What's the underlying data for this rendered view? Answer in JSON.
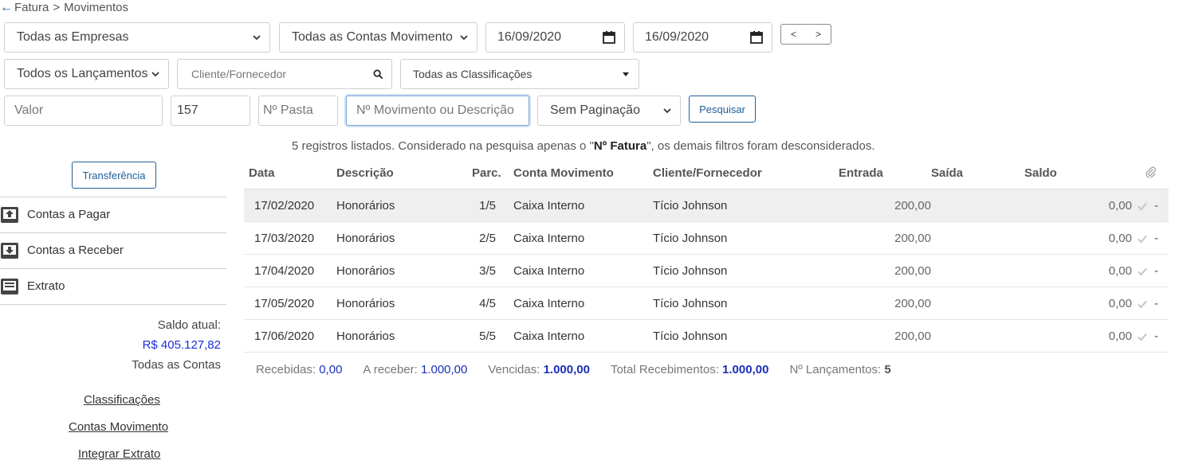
{
  "breadcrumb": {
    "back_icon": "arrow-left-icon",
    "root": "Fatura",
    "separator": ">",
    "current": "Movimentos"
  },
  "filters": {
    "empresas": "Todas as Empresas",
    "contas": "Todas as Contas Movimento",
    "date_from": "16/09/2020",
    "date_to": "16/09/2020",
    "prev": "<",
    "next": ">",
    "lancamentos": "Todos os Lançamentos",
    "cliente_placeholder": "Cliente/Fornecedor",
    "classificacoes": "Todas as Classificações",
    "valor_placeholder": "Valor",
    "fatura_value": "157",
    "pasta_placeholder": "Nº Pasta",
    "movimento_placeholder": "Nº Movimento ou Descrição",
    "paginacao": "Sem Paginação",
    "search_button": "Pesquisar"
  },
  "info": {
    "prefix": "5 registros listados. Considerado na pesquisa apenas o \"",
    "highlight": "Nº Fatura",
    "suffix": "\", os demais filtros foram desconsiderados."
  },
  "sidebar": {
    "transfer_button": "Transferência",
    "items": [
      {
        "label": "Contas a Pagar",
        "icon": "upload-box-icon"
      },
      {
        "label": "Contas a Receber",
        "icon": "download-box-icon"
      },
      {
        "label": "Extrato",
        "icon": "statement-icon"
      }
    ],
    "saldo_label": "Saldo atual:",
    "saldo_value": "R$ 405.127,82",
    "saldo_scope": "Todas as Contas",
    "links": [
      "Classificações",
      "Contas Movimento",
      "Integrar Extrato"
    ]
  },
  "table": {
    "headers": [
      "Data",
      "Descrição",
      "Parc.",
      "Conta Movimento",
      "Cliente/Fornecedor",
      "Entrada",
      "Saída",
      "Saldo"
    ],
    "attachment_icon": "paperclip-icon",
    "rows": [
      {
        "data": "17/02/2020",
        "descricao": "Honorários",
        "parc": "1/5",
        "conta": "Caixa Interno",
        "cliente": "Tício Johnson",
        "entrada": "200,00",
        "saida": "",
        "saldo": "0,00",
        "anexo": "-"
      },
      {
        "data": "17/03/2020",
        "descricao": "Honorários",
        "parc": "2/5",
        "conta": "Caixa Interno",
        "cliente": "Tício Johnson",
        "entrada": "200,00",
        "saida": "",
        "saldo": "0,00",
        "anexo": "-"
      },
      {
        "data": "17/04/2020",
        "descricao": "Honorários",
        "parc": "3/5",
        "conta": "Caixa Interno",
        "cliente": "Tício Johnson",
        "entrada": "200,00",
        "saida": "",
        "saldo": "0,00",
        "anexo": "-"
      },
      {
        "data": "17/05/2020",
        "descricao": "Honorários",
        "parc": "4/5",
        "conta": "Caixa Interno",
        "cliente": "Tício Johnson",
        "entrada": "200,00",
        "saida": "",
        "saldo": "0,00",
        "anexo": "-"
      },
      {
        "data": "17/06/2020",
        "descricao": "Honorários",
        "parc": "5/5",
        "conta": "Caixa Interno",
        "cliente": "Tício Johnson",
        "entrada": "200,00",
        "saida": "",
        "saldo": "0,00",
        "anexo": "-"
      }
    ]
  },
  "totals": {
    "recebidas_label": "Recebidas:",
    "recebidas": "0,00",
    "areceber_label": "A receber:",
    "areceber": "1.000,00",
    "vencidas_label": "Vencidas:",
    "vencidas": "1.000,00",
    "total_label": "Total Recebimentos:",
    "total": "1.000,00",
    "lanc_label": "Nº Lançamentos:",
    "lanc": "5"
  },
  "colors": {
    "primary": "#1e5e9a",
    "value_blue": "#1b2fb8",
    "row_highlight": "#efefef"
  }
}
